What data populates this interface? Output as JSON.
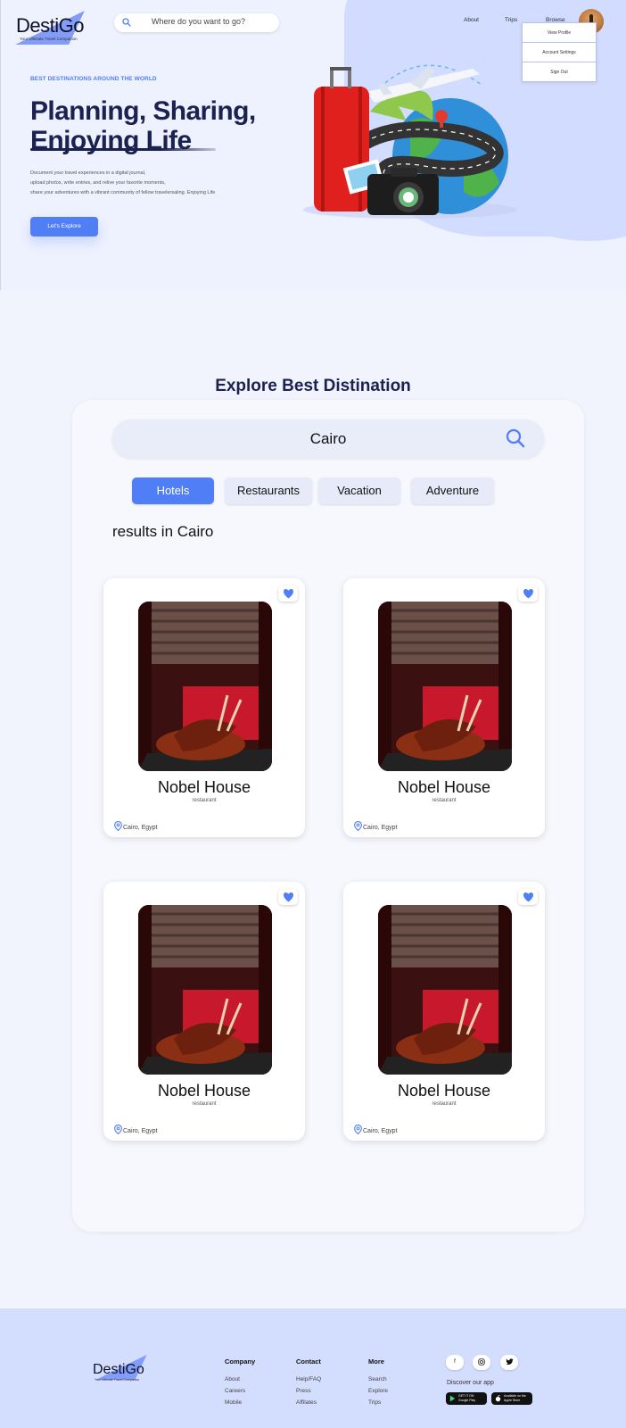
{
  "header": {
    "logo_text": "DestiGo",
    "logo_sub": "Your Ultimate Travel Companion",
    "search_placeholder": "Where do you want to go?",
    "nav": [
      "About",
      "Trips",
      "Browse"
    ],
    "profile_menu": [
      "View Profile",
      "Account Settings",
      "Sign Out"
    ]
  },
  "hero": {
    "tagline": "BEST DESTINATIONS AROUND THE WORLD",
    "headline_line1": "Planning, Sharing,",
    "headline_line2": "Enjoying Life",
    "description": [
      "Document your travel experiences in a digital journal,",
      "upload photos, write entries, and relive your favorite moments,",
      "share your adventures with a vibrant community of fellow travelersaling. Enjoying Life"
    ],
    "cta_label": "Let's Explore"
  },
  "explore": {
    "title": "Explore Best Distination",
    "search_value": "Cairo",
    "categories": [
      {
        "label": "Hotels",
        "active": true
      },
      {
        "label": "Restaurants",
        "active": false
      },
      {
        "label": "Vacation",
        "active": false
      },
      {
        "label": "Adventure",
        "active": false
      }
    ],
    "results_label": "results in Cairo",
    "cards": [
      {
        "name": "Nobel House",
        "type": "restaurant",
        "location": "Cairo, Egypt",
        "favorite": true
      },
      {
        "name": "Nobel House",
        "type": "restaurant",
        "location": "Cairo, Egypt",
        "favorite": true
      },
      {
        "name": "Nobel House",
        "type": "restaurant",
        "location": "Cairo, Egypt",
        "favorite": true
      },
      {
        "name": "Nobel House",
        "type": "restaurant",
        "location": "Cairo, Egypt",
        "favorite": true
      }
    ]
  },
  "footer": {
    "logo_text": "DestiGo",
    "logo_sub": "Your Ultimate Travel Companion",
    "columns": [
      {
        "heading": "Company",
        "links": [
          "About",
          "Careers",
          "Mobile"
        ]
      },
      {
        "heading": "Contact",
        "links": [
          "Help/FAQ",
          "Press",
          "Affilates"
        ]
      },
      {
        "heading": "More",
        "links": [
          "Search",
          "Explore",
          "Trips"
        ]
      }
    ],
    "social": [
      "f",
      "ig",
      "tw"
    ],
    "discover_label": "Discover our app",
    "stores": [
      {
        "small": "GET IT ON",
        "big": "Google Play"
      },
      {
        "small": "Available on the",
        "big": "Apple Store"
      }
    ]
  },
  "colors": {
    "accent": "#4f7ef7",
    "navy": "#1b2150",
    "hero_bg": "#eef1fe",
    "blob": "#d2dcfe",
    "footer_bg": "#d3ddfd"
  }
}
